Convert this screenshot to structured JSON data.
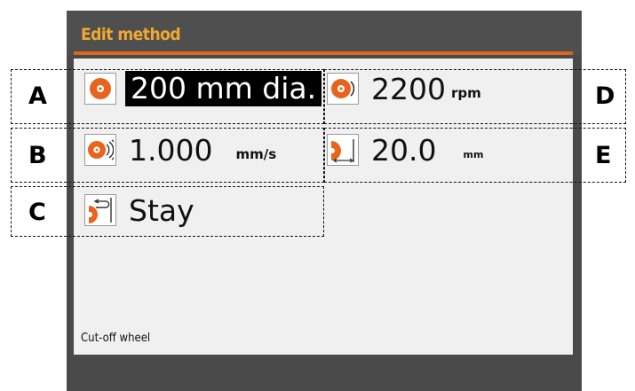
{
  "window": {
    "title": "Edit method"
  },
  "params": {
    "diameter": {
      "value": "200 mm dia.",
      "unit": ""
    },
    "speed": {
      "value": "2200",
      "unit": "rpm"
    },
    "feed": {
      "value": "1.000",
      "unit": "mm/s"
    },
    "distance": {
      "value": "20.0",
      "unit": "mm"
    },
    "end_position": {
      "value": "Stay",
      "unit": ""
    }
  },
  "footer": {
    "label": "Cut-off wheel"
  },
  "callouts": {
    "a": "A",
    "b": "B",
    "c": "C",
    "d": "D",
    "e": "E"
  },
  "colors": {
    "title_text": "#f0a830",
    "accent_line": "#d9661a",
    "icon_orange": "#e8641e",
    "panel_bg": "#f0f0f0",
    "frame_bg": "#4a4a4a"
  },
  "icons": {
    "diameter": "wheel-icon",
    "speed": "wheel-rotation-icon",
    "feed": "wheel-feed-icon",
    "distance": "wheel-distance-icon",
    "end_position": "wheel-return-icon"
  }
}
